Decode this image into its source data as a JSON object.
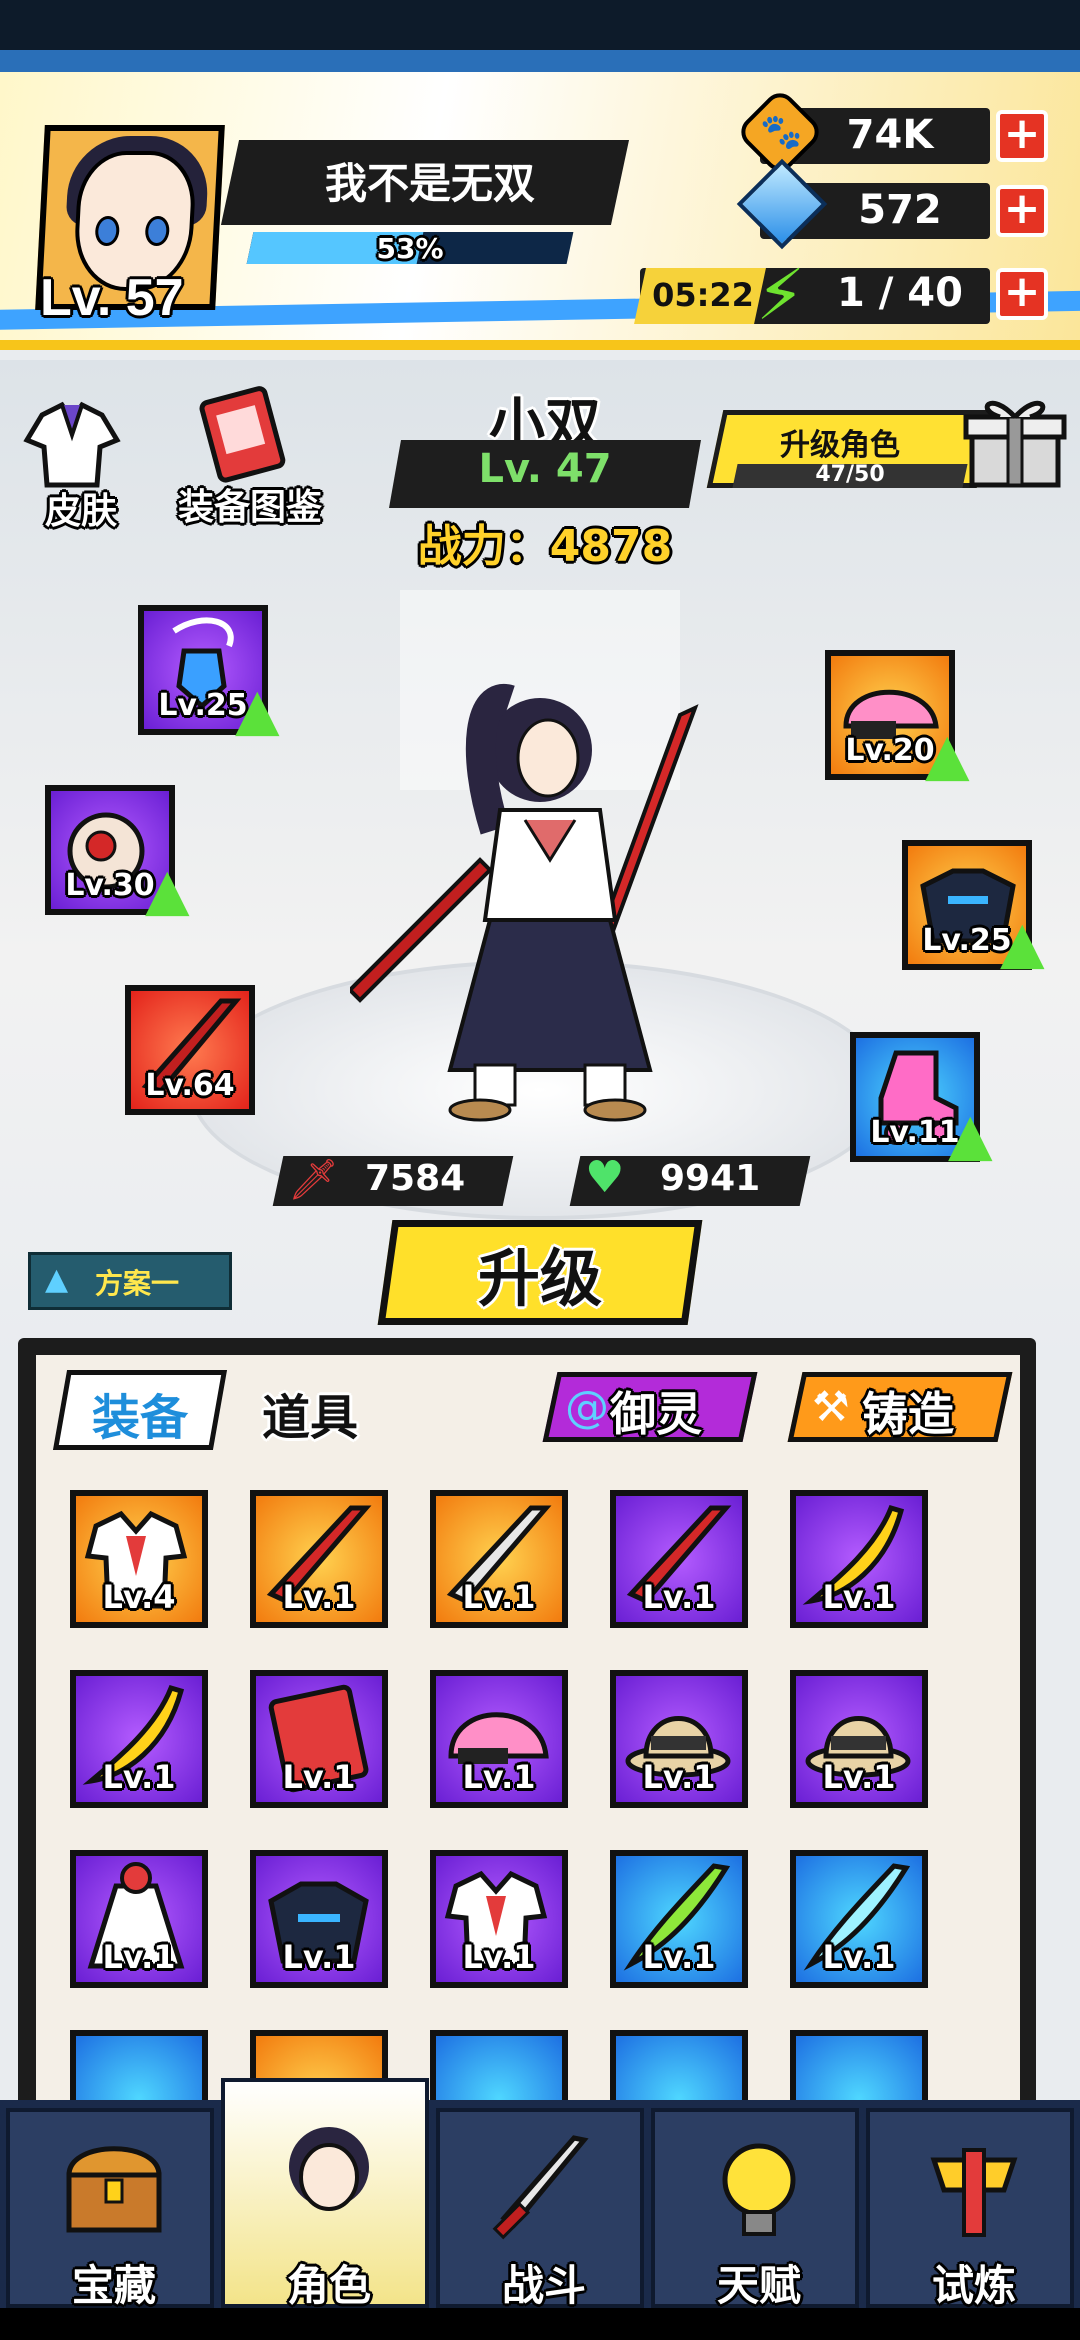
{
  "player": {
    "name": "我不是无双",
    "level": "Lv. 57",
    "exp_percent": "53%",
    "exp_fraction": 0.53
  },
  "resources": {
    "paw": {
      "value": "74K",
      "icon": "paw-coin-icon"
    },
    "diamond": {
      "value": "572",
      "icon": "diamond-icon"
    },
    "energy": {
      "value": "1 / 40",
      "timer": "05:22",
      "icon": "lightning-icon"
    }
  },
  "top_actions": {
    "skin": "皮肤",
    "codex": "装备图鉴"
  },
  "character": {
    "name": "小双",
    "level": "Lv. 47",
    "power": "战力：4878",
    "attack": "7584",
    "hp": "9941"
  },
  "upgrade_role": {
    "label": "升级角色",
    "progress": "47/50"
  },
  "left_slots": [
    {
      "level": "Lv.25",
      "icon": "pendant-icon",
      "upgrade": true
    },
    {
      "level": "Lv.30",
      "icon": "ring-icon",
      "upgrade": true
    },
    {
      "level": "Lv.64",
      "icon": "red-blade-icon",
      "upgrade": false
    }
  ],
  "right_slots": [
    {
      "level": "Lv.20",
      "icon": "pink-helmet-icon",
      "upgrade": true
    },
    {
      "level": "Lv.25",
      "icon": "dark-armor-icon",
      "upgrade": true
    },
    {
      "level": "Lv.11",
      "icon": "roller-skate-icon",
      "upgrade": true
    }
  ],
  "level_up_button": "升级",
  "plan_button": "方案一",
  "inventory": {
    "tab_equip": "装备",
    "tab_items": "道具",
    "spirit_button": "御灵",
    "forge_button": "铸造",
    "items": [
      {
        "level": "Lv.4",
        "color": "orange",
        "icon": "sailor-uniform-icon"
      },
      {
        "level": "Lv.1",
        "color": "orange",
        "icon": "red-blade-icon"
      },
      {
        "level": "Lv.1",
        "color": "orange",
        "icon": "white-blade-icon"
      },
      {
        "level": "Lv.1",
        "color": "purple",
        "icon": "red-blade-icon"
      },
      {
        "level": "Lv.1",
        "color": "purple",
        "icon": "banana-blade-icon"
      },
      {
        "level": "Lv.1",
        "color": "purple",
        "icon": "banana-blade-icon"
      },
      {
        "level": "Lv.1",
        "color": "purple",
        "icon": "rabbit-book-icon"
      },
      {
        "level": "Lv.1",
        "color": "purple",
        "icon": "pink-helmet-icon"
      },
      {
        "level": "Lv.1",
        "color": "purple",
        "icon": "safari-hat-icon"
      },
      {
        "level": "Lv.1",
        "color": "purple",
        "icon": "safari-hat-icon"
      },
      {
        "level": "Lv.1",
        "color": "purple",
        "icon": "maid-dress-icon"
      },
      {
        "level": "Lv.1",
        "color": "purple",
        "icon": "dark-armor-icon"
      },
      {
        "level": "Lv.1",
        "color": "purple",
        "icon": "sailor-uniform-icon"
      },
      {
        "level": "Lv.1",
        "color": "blue",
        "icon": "green-blade-icon"
      },
      {
        "level": "Lv.1",
        "color": "blue",
        "icon": "ice-blade-icon"
      }
    ]
  },
  "nav": [
    {
      "label": "宝藏",
      "icon": "treasure-chest-icon",
      "active": false
    },
    {
      "label": "角色",
      "icon": "character-icon",
      "active": true
    },
    {
      "label": "战斗",
      "icon": "sword-icon",
      "active": false
    },
    {
      "label": "天赋",
      "icon": "lightbulb-icon",
      "active": false
    },
    {
      "label": "试炼",
      "icon": "trophy-sword-icon",
      "active": false
    }
  ]
}
